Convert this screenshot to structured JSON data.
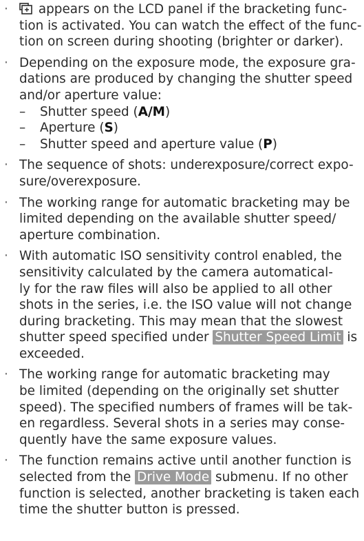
{
  "items": [
    {
      "lines": [
        {
          "icon": "bracketing-icon",
          "text": " appears on the LCD panel if the bracketing func-"
        },
        {
          "text": "tion is activated. You can watch the effect of the func-"
        },
        {
          "text": "tion on screen during shooting (brighter or darker)."
        }
      ]
    },
    {
      "lines": [
        {
          "text": "Depending on the exposure mode, the exposure gra-"
        },
        {
          "text": "dations are produced by changing the shutter speed"
        },
        {
          "text": "and/or aperture value:"
        }
      ],
      "sub": [
        {
          "prefix": "Shutter speed (",
          "bold": "A/M",
          "suffix": ")"
        },
        {
          "prefix": "Aperture (",
          "bold": "S",
          "suffix": ")"
        },
        {
          "prefix": "Shutter speed and aperture value (",
          "bold": "P",
          "suffix": ")"
        }
      ]
    },
    {
      "lines": [
        {
          "text": "The sequence of shots: underexposure/correct expo-"
        },
        {
          "text": "sure/overexposure."
        }
      ]
    },
    {
      "lines": [
        {
          "text": "The working range for automatic bracketing may be"
        },
        {
          "text": "limited depending on the available shutter speed/"
        },
        {
          "text": "aperture combination."
        }
      ]
    },
    {
      "lines": [
        {
          "text": "With automatic ISO sensitivity control enabled, the"
        },
        {
          "text": "sensitivity calculated by the camera automatical-"
        },
        {
          "text": "ly for the raw files will also be applied to all other"
        },
        {
          "text": "shots in the series, i.e. the ISO value will not change"
        },
        {
          "text": "during bracketing. This may mean that the slowest"
        },
        {
          "text": "shutter speed specified under ",
          "menu": "Shutter Speed Limit",
          "after": " is"
        },
        {
          "text": "exceeded."
        }
      ]
    },
    {
      "lines": [
        {
          "text": "The working range for automatic bracketing may"
        },
        {
          "text": "be limited (depending on the originally set shutter"
        },
        {
          "text": "speed). The specified numbers of frames will be tak-"
        },
        {
          "text": "en regardless. Several shots in a series may conse-"
        },
        {
          "text": "quently have the same exposure values."
        }
      ]
    },
    {
      "lines": [
        {
          "text": "The function remains active until another function is"
        },
        {
          "text": "selected from the ",
          "menu": "Drive Mode",
          "after": " submenu. If no other"
        },
        {
          "text": "function is selected, another bracketing is taken each"
        },
        {
          "text": "time the shutter button is pressed."
        }
      ]
    }
  ]
}
